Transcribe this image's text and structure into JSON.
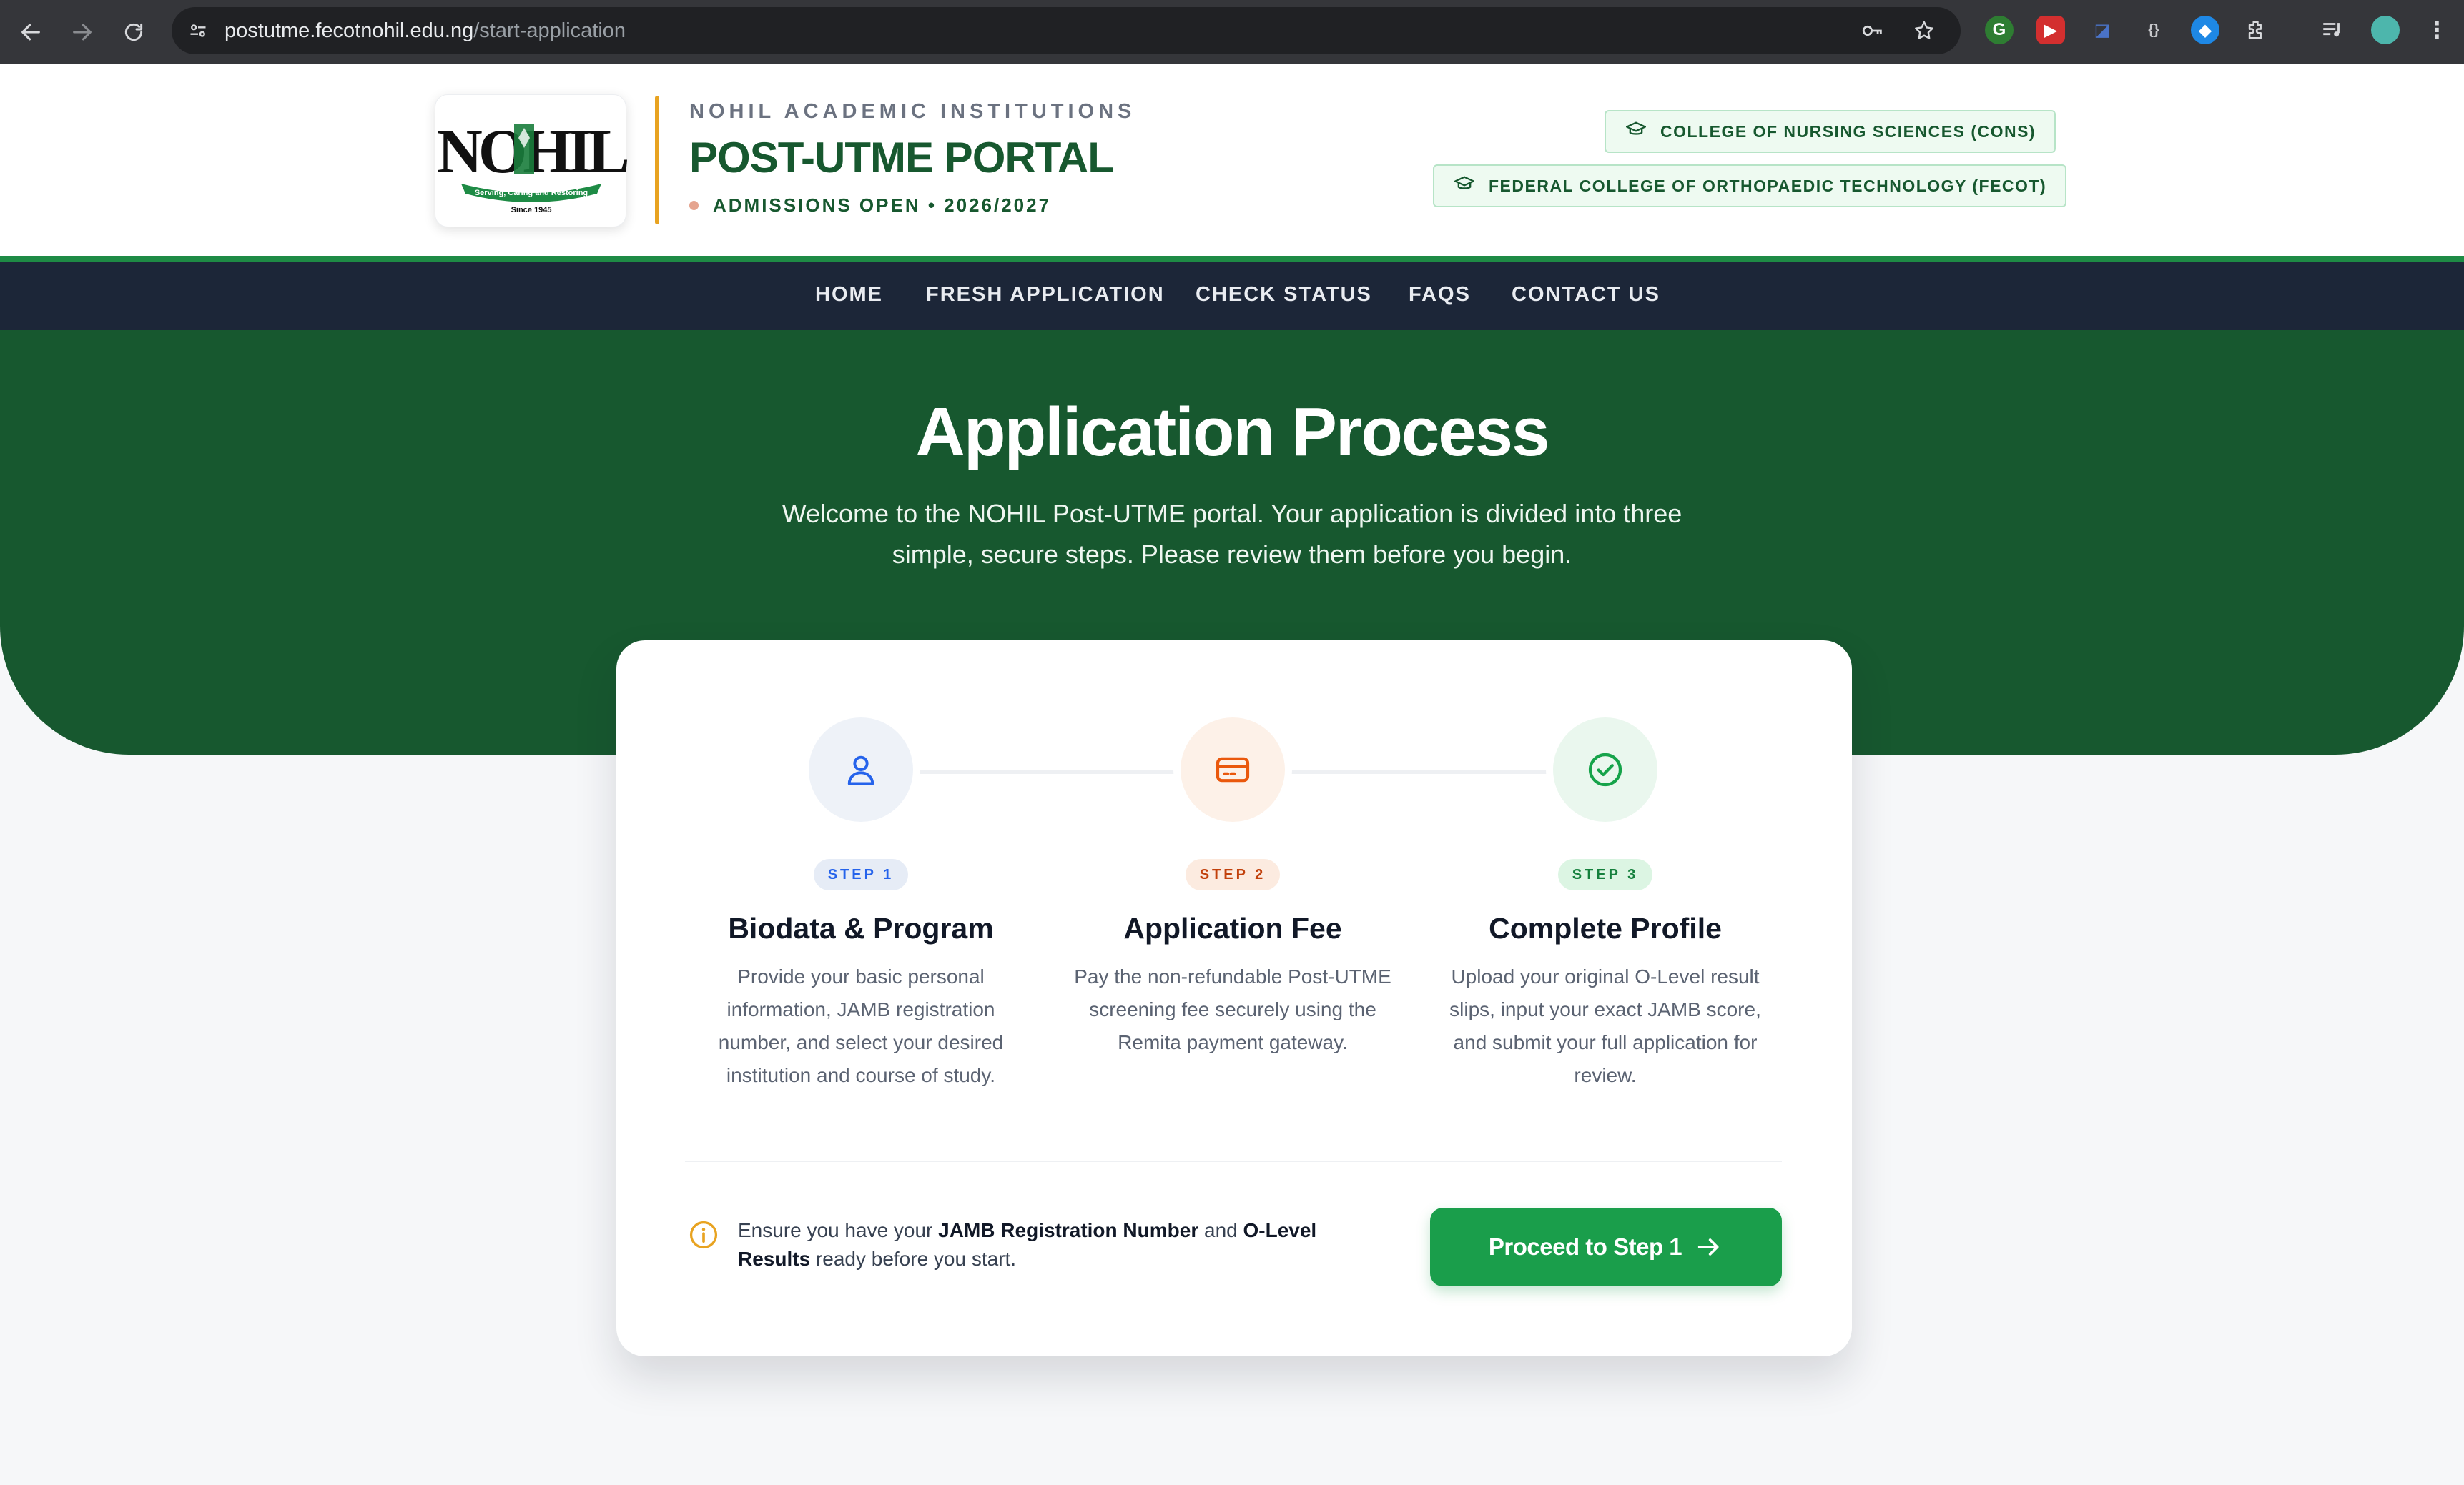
{
  "browser": {
    "url_host": "postutme.fecotnohil.edu.ng",
    "url_path": "/start-application",
    "icons": [
      "back-icon",
      "forward-icon",
      "reload-icon",
      "site-settings-icon",
      "password-key-icon",
      "bookmark-star-icon",
      "extensions-icon",
      "media-control-icon",
      "profile-avatar-icon",
      "menu-kebab-icon"
    ]
  },
  "header": {
    "logo_text": "NOHIL",
    "logo_ribbon": "Serving, Caring and Restoring",
    "logo_since": "Since 1945",
    "subtitle": "NOHIL ACADEMIC INSTITUTIONS",
    "title": "POST-UTME PORTAL",
    "admissions": "ADMISSIONS OPEN • 2026/2027",
    "colleges": [
      {
        "label": "COLLEGE OF NURSING SCIENCES (CONS)",
        "icon": "graduation-cap-icon"
      },
      {
        "label": "FEDERAL COLLEGE OF ORTHOPAEDIC TECHNOLOGY (FECOT)",
        "icon": "graduation-cap-icon"
      }
    ]
  },
  "nav": {
    "items": [
      {
        "label": "HOME"
      },
      {
        "label": "FRESH APPLICATION"
      },
      {
        "label": "CHECK STATUS"
      },
      {
        "label": "FAQS"
      },
      {
        "label": "CONTACT US"
      }
    ]
  },
  "hero": {
    "title": "Application Process",
    "text": "Welcome to the NOHIL Post-UTME portal. Your application is divided into three simple, secure steps. Please review them before you begin."
  },
  "steps": [
    {
      "badge": "STEP 1",
      "title": "Biodata & Program",
      "desc": "Provide your basic personal information, JAMB registration number, and select your desired institution and course of study.",
      "icon": "user-icon",
      "color": "#2563eb"
    },
    {
      "badge": "STEP 2",
      "title": "Application Fee",
      "desc": "Pay the non-refundable Post-UTME screening fee securely using the Remita payment gateway.",
      "icon": "credit-card-icon",
      "color": "#ea580c"
    },
    {
      "badge": "STEP 3",
      "title": "Complete Profile",
      "desc": "Upload your original O-Level result slips, input your exact JAMB score, and submit your full application for review.",
      "icon": "check-circle-icon",
      "color": "#16a34a"
    }
  ],
  "notice": {
    "prefix": "Ensure you have your",
    "bold1": "JAMB Registration Number",
    "middle": "and",
    "bold2": "O-Level Results",
    "suffix": "ready before you start.",
    "icon": "info-icon"
  },
  "cta": {
    "label": "Proceed to Step 1",
    "icon": "arrow-right-icon"
  },
  "colors": {
    "brand_green": "#17582f",
    "nav_dark": "#1c2638",
    "accent_gold": "#e8a321",
    "button_green": "#1a9e4b"
  }
}
